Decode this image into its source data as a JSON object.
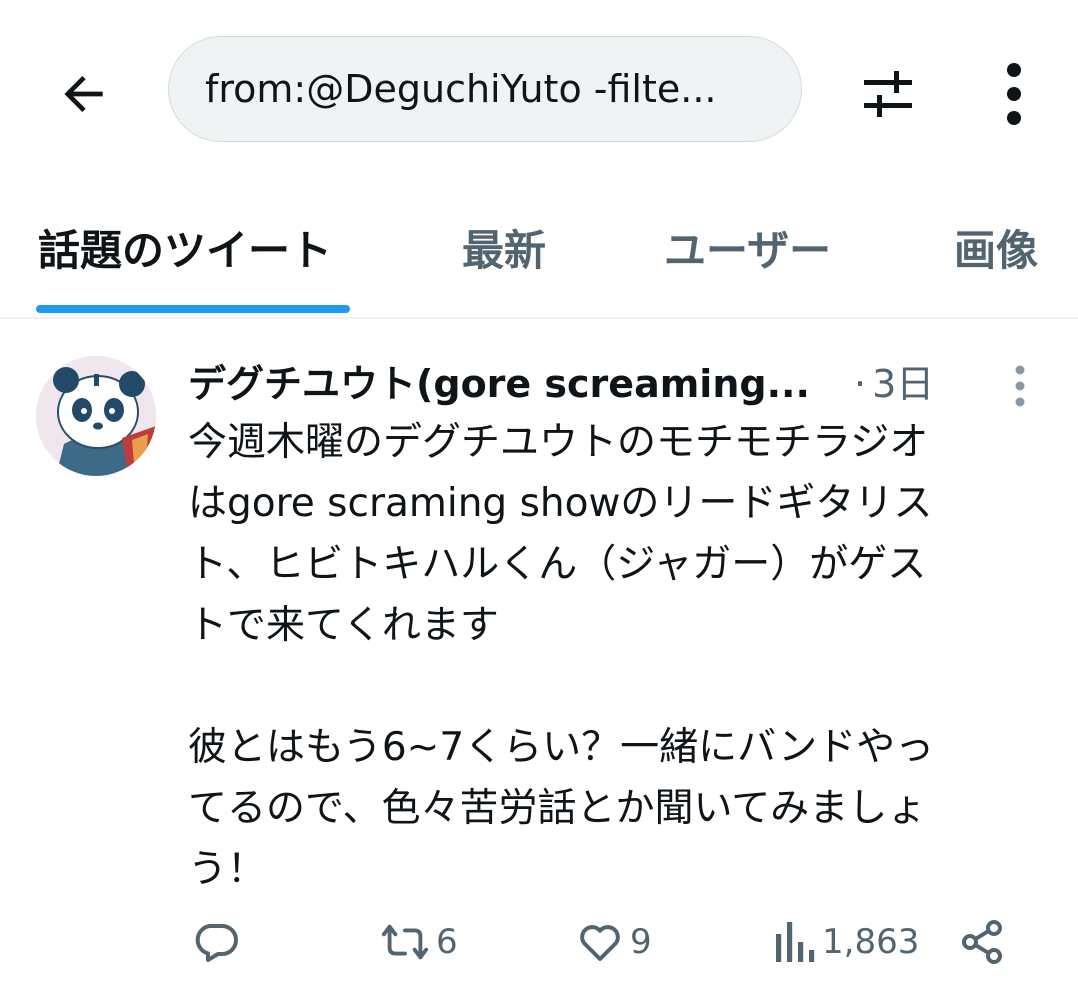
{
  "header": {
    "back_icon": "arrow-left-icon",
    "search_query": "from:@DeguchiYuto -filte...",
    "filter_icon": "sliders-icon",
    "more_icon": "vertical-dots-icon"
  },
  "tabs": [
    {
      "label": "話題のツイート",
      "active": true
    },
    {
      "label": "最新",
      "active": false
    },
    {
      "label": "ユーザー",
      "active": false
    },
    {
      "label": "画像",
      "active": false
    }
  ],
  "tweet": {
    "author": "デグチユウト(gore screaming...",
    "separator": "·",
    "time": "3日",
    "body": "今週木曜のデグチユウトのモチモチラジオ\nはgore scraming showのリードギタリス\nト、ヒビトキハルくん（ジャガー）がゲス\nトで来てくれます\n\n彼とはもう6~7くらい？一緒にバンドやっ\nてるので、色々苦労話とか聞いてみましょ\nう！",
    "actions": {
      "reply_count": "",
      "retweet_count": "6",
      "like_count": "9",
      "view_count": "1,863"
    }
  },
  "colors": {
    "accent": "#1d9bf0",
    "text": "#0f1419",
    "muted": "#536471",
    "pill_bg": "#eff3f4"
  }
}
